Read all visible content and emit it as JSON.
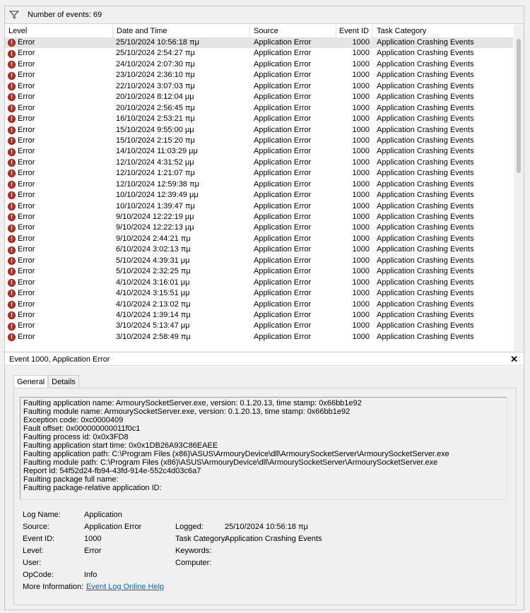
{
  "toolbar": {
    "events_count": "Number of events: 69"
  },
  "grid": {
    "columns": [
      "Level",
      "Date and Time",
      "Source",
      "Event ID",
      "Task Category"
    ],
    "rows": [
      {
        "level": "Error",
        "date": "25/10/2024 10:56:18 πμ",
        "source": "Application Error",
        "id": "1000",
        "category": "Application Crashing Events"
      },
      {
        "level": "Error",
        "date": "25/10/2024 2:54:27 πμ",
        "source": "Application Error",
        "id": "1000",
        "category": "Application Crashing Events"
      },
      {
        "level": "Error",
        "date": "24/10/2024 2:07:30 πμ",
        "source": "Application Error",
        "id": "1000",
        "category": "Application Crashing Events"
      },
      {
        "level": "Error",
        "date": "23/10/2024 2:36:10 πμ",
        "source": "Application Error",
        "id": "1000",
        "category": "Application Crashing Events"
      },
      {
        "level": "Error",
        "date": "22/10/2024 3:07:03 πμ",
        "source": "Application Error",
        "id": "1000",
        "category": "Application Crashing Events"
      },
      {
        "level": "Error",
        "date": "20/10/2024 8:12:04 μμ",
        "source": "Application Error",
        "id": "1000",
        "category": "Application Crashing Events"
      },
      {
        "level": "Error",
        "date": "20/10/2024 2:56:45 πμ",
        "source": "Application Error",
        "id": "1000",
        "category": "Application Crashing Events"
      },
      {
        "level": "Error",
        "date": "16/10/2024 2:53:21 πμ",
        "source": "Application Error",
        "id": "1000",
        "category": "Application Crashing Events"
      },
      {
        "level": "Error",
        "date": "15/10/2024 9:55:00 μμ",
        "source": "Application Error",
        "id": "1000",
        "category": "Application Crashing Events"
      },
      {
        "level": "Error",
        "date": "15/10/2024 2:15:20 πμ",
        "source": "Application Error",
        "id": "1000",
        "category": "Application Crashing Events"
      },
      {
        "level": "Error",
        "date": "14/10/2024 11:03:29 μμ",
        "source": "Application Error",
        "id": "1000",
        "category": "Application Crashing Events"
      },
      {
        "level": "Error",
        "date": "12/10/2024 4:31:52 μμ",
        "source": "Application Error",
        "id": "1000",
        "category": "Application Crashing Events"
      },
      {
        "level": "Error",
        "date": "12/10/2024 1:21:07 πμ",
        "source": "Application Error",
        "id": "1000",
        "category": "Application Crashing Events"
      },
      {
        "level": "Error",
        "date": "12/10/2024 12:59:38 πμ",
        "source": "Application Error",
        "id": "1000",
        "category": "Application Crashing Events"
      },
      {
        "level": "Error",
        "date": "10/10/2024 12:39:49 μμ",
        "source": "Application Error",
        "id": "1000",
        "category": "Application Crashing Events"
      },
      {
        "level": "Error",
        "date": "10/10/2024 1:39:47 πμ",
        "source": "Application Error",
        "id": "1000",
        "category": "Application Crashing Events"
      },
      {
        "level": "Error",
        "date": "9/10/2024 12:22:19 μμ",
        "source": "Application Error",
        "id": "1000",
        "category": "Application Crashing Events"
      },
      {
        "level": "Error",
        "date": "9/10/2024 12:22:13 μμ",
        "source": "Application Error",
        "id": "1000",
        "category": "Application Crashing Events"
      },
      {
        "level": "Error",
        "date": "9/10/2024 2:44:21 πμ",
        "source": "Application Error",
        "id": "1000",
        "category": "Application Crashing Events"
      },
      {
        "level": "Error",
        "date": "6/10/2024 3:02:13 πμ",
        "source": "Application Error",
        "id": "1000",
        "category": "Application Crashing Events"
      },
      {
        "level": "Error",
        "date": "5/10/2024 4:39:31 μμ",
        "source": "Application Error",
        "id": "1000",
        "category": "Application Crashing Events"
      },
      {
        "level": "Error",
        "date": "5/10/2024 2:32:25 πμ",
        "source": "Application Error",
        "id": "1000",
        "category": "Application Crashing Events"
      },
      {
        "level": "Error",
        "date": "4/10/2024 3:16:01 μμ",
        "source": "Application Error",
        "id": "1000",
        "category": "Application Crashing Events"
      },
      {
        "level": "Error",
        "date": "4/10/2024 3:15:51 μμ",
        "source": "Application Error",
        "id": "1000",
        "category": "Application Crashing Events"
      },
      {
        "level": "Error",
        "date": "4/10/2024 2:13:02 πμ",
        "source": "Application Error",
        "id": "1000",
        "category": "Application Crashing Events"
      },
      {
        "level": "Error",
        "date": "4/10/2024 1:39:14 πμ",
        "source": "Application Error",
        "id": "1000",
        "category": "Application Crashing Events"
      },
      {
        "level": "Error",
        "date": "3/10/2024 5:13:47 μμ",
        "source": "Application Error",
        "id": "1000",
        "category": "Application Crashing Events"
      },
      {
        "level": "Error",
        "date": "3/10/2024 2:58:49 πμ",
        "source": "Application Error",
        "id": "1000",
        "category": "Application Crashing Events"
      }
    ]
  },
  "details": {
    "title": "Event 1000, Application Error",
    "tabs": [
      "General",
      "Details"
    ],
    "message_lines": [
      "Faulting application name: ArmourySocketServer.exe, version: 0.1.20.13, time stamp: 0x66bb1e92",
      "Faulting module name: ArmourySocketServer.exe, version: 0.1.20.13, time stamp: 0x66bb1e92",
      "Exception code: 0xc0000409",
      "Fault offset: 0x000000000011f0c1",
      "Faulting process id: 0x0x3FD8",
      "Faulting application start time: 0x0x1DB26A93C86EAEE",
      "Faulting application path: C:\\Program Files (x86)\\ASUS\\ArmouryDevice\\dll\\ArmourySocketServer\\ArmourySocketServer.exe",
      "Faulting module path: C:\\Program Files (x86)\\ASUS\\ArmouryDevice\\dll\\ArmourySocketServer\\ArmourySocketServer.exe",
      "Report Id: 54f52d24-fb94-43fd-914e-552c4d03c6a7",
      "Faulting package full name:",
      "Faulting package-relative application ID:"
    ],
    "props": {
      "log_name_label": "Log Name:",
      "log_name": "Application",
      "source_label": "Source:",
      "source": "Application Error",
      "logged_label": "Logged:",
      "logged": "25/10/2024 10:56:18 πμ",
      "event_id_label": "Event ID:",
      "event_id": "1000",
      "task_category_label": "Task Category:",
      "task_category": "Application Crashing Events",
      "level_label": "Level:",
      "level": "Error",
      "keywords_label": "Keywords:",
      "user_label": "User:",
      "computer_label": "Computer:",
      "opcode_label": "OpCode:",
      "opcode": "Info",
      "more_info_label": "More Information:",
      "more_info_link": "Event Log Online Help"
    }
  }
}
